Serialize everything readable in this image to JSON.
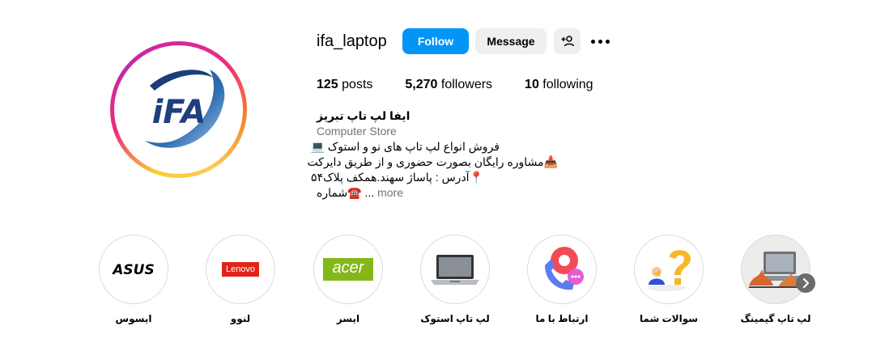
{
  "profile": {
    "username": "ifa_laptop",
    "follow_label": "Follow",
    "message_label": "Message",
    "avatar_logo_text": "iFA"
  },
  "stats": {
    "posts_count": "125",
    "posts_label": "posts",
    "followers_count": "5,270",
    "followers_label": "followers",
    "following_count": "10",
    "following_label": "following"
  },
  "bio": {
    "name": "ایفا لپ تاپ تبریز",
    "category": "Computer Store",
    "lines": [
      "فروش انواع لپ تاپ های نو و استوک 💻",
      "📥مشاوره رایگان بصورت حضوری و از طریق دایرکت",
      "📍آدرس : پاساژ سهند.همکف پلاک۵۴",
      "☎️شماره"
    ],
    "ellipsis": "...",
    "more_label": "more"
  },
  "highlights": [
    {
      "label": "ایسوس",
      "logo": "ASUS"
    },
    {
      "label": "لنوو",
      "logo": "Lenovo"
    },
    {
      "label": "ایسر",
      "logo": "acer"
    },
    {
      "label": "لپ تاپ استوک",
      "logo": "laptop-icon"
    },
    {
      "label": "ارتباط با ما",
      "logo": "phone-chat-icon"
    },
    {
      "label": "سوالات شما",
      "logo": "question-icon"
    },
    {
      "label": "لپ تاپ گیمینگ",
      "logo": "gaming-laptop-icon"
    }
  ],
  "colors": {
    "follow_button": "#0095f6",
    "secondary_button": "#efefef",
    "muted_text": "#737373",
    "lenovo_red": "#e2231a",
    "acer_green": "#83b81a"
  }
}
